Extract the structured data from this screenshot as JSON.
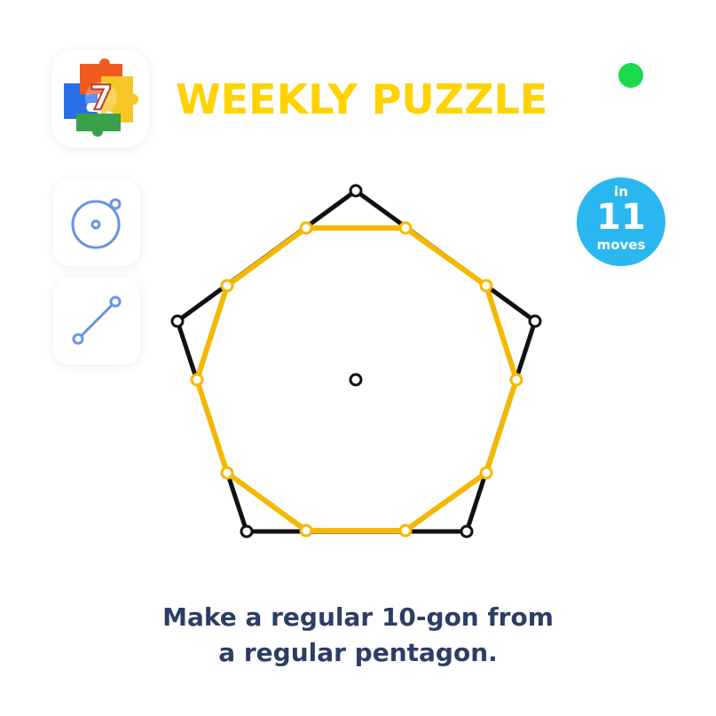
{
  "header": {
    "app_icon": {
      "icon": "puzzle-pieces-icon",
      "number": "7"
    },
    "title": "WEEKLY PUZZLE",
    "status_dot_color": "#1ad94a"
  },
  "tools": [
    {
      "name": "compass-tool",
      "icon": "circle-with-point-icon"
    },
    {
      "name": "straightedge-tool",
      "icon": "line-segment-icon"
    }
  ],
  "moves_badge": {
    "top_text": "in",
    "count": "11",
    "bottom_text": "moves"
  },
  "instruction": {
    "line1": "Make a regular 10-gon from",
    "line2": "a regular pentagon."
  },
  "colors": {
    "title": "#ffd200",
    "tool_icon": "#6a93e6",
    "badge": "#2ab7f0",
    "pentagon": "#111111",
    "decagon": "#f5b800",
    "instruction": "#2c3e66",
    "status_dot": "#1ad94a"
  }
}
